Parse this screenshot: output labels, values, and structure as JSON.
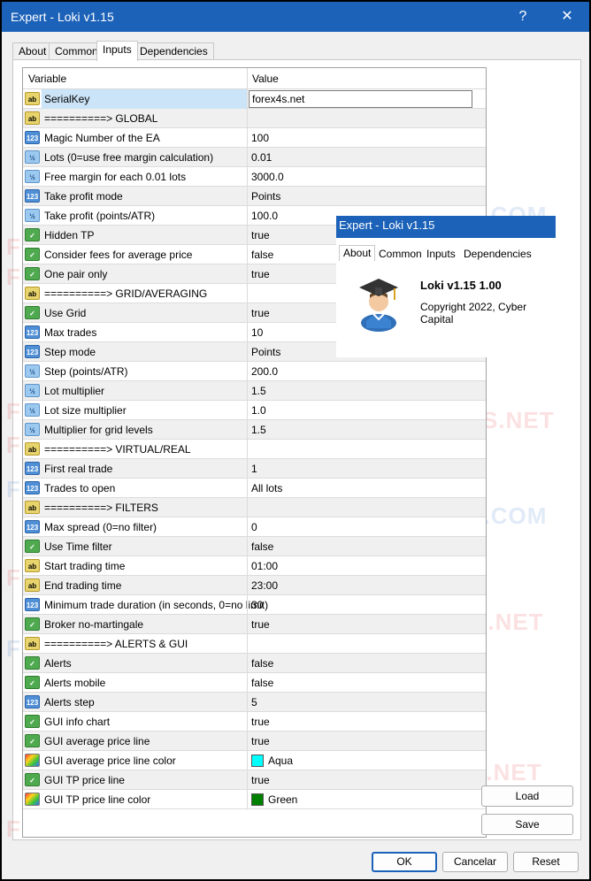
{
  "window": {
    "title": "Expert - Loki v1.15",
    "help_glyph": "?",
    "close_glyph": "✕"
  },
  "tabs": [
    {
      "label": "About"
    },
    {
      "label": "Common"
    },
    {
      "label": "Inputs"
    },
    {
      "label": "Dependencies"
    }
  ],
  "grid": {
    "columns": {
      "variable": "Variable",
      "value": "Value"
    },
    "rows": [
      {
        "type": "ab",
        "icon_text": "ab",
        "variable": "SerialKey",
        "value": "forex4s.net"
      },
      {
        "type": "ab",
        "icon_text": "ab",
        "variable": "==========> GLOBAL",
        "value": ""
      },
      {
        "type": "num",
        "icon_text": "123",
        "variable": "Magic Number of the EA",
        "value": "100"
      },
      {
        "type": "frac",
        "icon_text": "½",
        "variable": "Lots (0=use free margin calculation)",
        "value": "0.01"
      },
      {
        "type": "frac",
        "icon_text": "½",
        "variable": "Free margin for each 0.01 lots",
        "value": "3000.0"
      },
      {
        "type": "num",
        "icon_text": "123",
        "variable": "Take profit mode",
        "value": "Points"
      },
      {
        "type": "frac",
        "icon_text": "½",
        "variable": "Take profit (points/ATR)",
        "value": "100.0"
      },
      {
        "type": "bool",
        "icon_text": "✓",
        "variable": "Hidden TP",
        "value": "true"
      },
      {
        "type": "bool",
        "icon_text": "✓",
        "variable": "Consider fees for average price",
        "value": "false"
      },
      {
        "type": "bool",
        "icon_text": "✓",
        "variable": "One pair only",
        "value": "true"
      },
      {
        "type": "ab",
        "icon_text": "ab",
        "variable": "==========> GRID/AVERAGING",
        "value": ""
      },
      {
        "type": "bool",
        "icon_text": "✓",
        "variable": "Use Grid",
        "value": "true"
      },
      {
        "type": "num",
        "icon_text": "123",
        "variable": "Max trades",
        "value": "10"
      },
      {
        "type": "num",
        "icon_text": "123",
        "variable": "Step mode",
        "value": "Points"
      },
      {
        "type": "frac",
        "icon_text": "½",
        "variable": "Step (points/ATR)",
        "value": "200.0"
      },
      {
        "type": "frac",
        "icon_text": "½",
        "variable": "Lot multiplier",
        "value": "1.5"
      },
      {
        "type": "frac",
        "icon_text": "½",
        "variable": "Lot size multiplier",
        "value": "1.0"
      },
      {
        "type": "frac",
        "icon_text": "½",
        "variable": "Multiplier for grid levels",
        "value": "1.5"
      },
      {
        "type": "ab",
        "icon_text": "ab",
        "variable": "==========> VIRTUAL/REAL",
        "value": ""
      },
      {
        "type": "num",
        "icon_text": "123",
        "variable": "First real trade",
        "value": "1"
      },
      {
        "type": "num",
        "icon_text": "123",
        "variable": "Trades to open",
        "value": "All lots"
      },
      {
        "type": "ab",
        "icon_text": "ab",
        "variable": "==========> FILTERS",
        "value": ""
      },
      {
        "type": "num",
        "icon_text": "123",
        "variable": "Max spread (0=no filter)",
        "value": "0"
      },
      {
        "type": "bool",
        "icon_text": "✓",
        "variable": "Use Time filter",
        "value": "false"
      },
      {
        "type": "ab",
        "icon_text": "ab",
        "variable": "Start trading time",
        "value": "01:00"
      },
      {
        "type": "ab",
        "icon_text": "ab",
        "variable": "End trading time",
        "value": "23:00"
      },
      {
        "type": "num",
        "icon_text": "123",
        "variable": "Minimum trade duration (in seconds, 0=no limit)",
        "value": "30"
      },
      {
        "type": "bool",
        "icon_text": "✓",
        "variable": "Broker no-martingale",
        "value": "true"
      },
      {
        "type": "ab",
        "icon_text": "ab",
        "variable": "==========> ALERTS & GUI",
        "value": ""
      },
      {
        "type": "bool",
        "icon_text": "✓",
        "variable": "Alerts",
        "value": "false"
      },
      {
        "type": "bool",
        "icon_text": "✓",
        "variable": "Alerts mobile",
        "value": "false"
      },
      {
        "type": "num",
        "icon_text": "123",
        "variable": "Alerts step",
        "value": "5"
      },
      {
        "type": "bool",
        "icon_text": "✓",
        "variable": "GUI info chart",
        "value": "true"
      },
      {
        "type": "bool",
        "icon_text": "✓",
        "variable": "GUI average price line",
        "value": "true"
      },
      {
        "type": "color",
        "icon_text": "",
        "variable": "GUI average price line color",
        "value": "Aqua",
        "swatch": "#00ffff"
      },
      {
        "type": "bool",
        "icon_text": "✓",
        "variable": "GUI TP price line",
        "value": "true"
      },
      {
        "type": "color",
        "icon_text": "",
        "variable": "GUI TP price line color",
        "value": "Green",
        "swatch": "#008000"
      }
    ]
  },
  "side_buttons": {
    "load": "Load",
    "save": "Save"
  },
  "bottom_buttons": {
    "ok": "OK",
    "cancel": "Cancelar",
    "reset": "Reset"
  },
  "watermarks": [
    "FOREX4S.NET",
    "FOREX4S.NET",
    "FOREX4S.NET",
    "FOREX4S.NET",
    "FOREX4S.NET",
    "FOREX4S.NET",
    "FOREX4S.NET",
    "FOREX4S.NET",
    "FOREX4Y.COM",
    "FOREX4Y.COM",
    "FOREX4Y.COM",
    "FOREX4Y.COM",
    "FOREX4Y.COM",
    "FOREX4Y.COM",
    "FOREX4Y.COM",
    "FOREX4Y.COM",
    "FOREX4Y.NET",
    "FOREX4Y.NET",
    "FOREX4Y.NET",
    "FOREX4Y.NET",
    "FOREX4Y.NET",
    "FOREX4Y.NET",
    "FOREX4Y.NET"
  ],
  "about_popup": {
    "title": "Expert - Loki v1.15",
    "tabs": [
      "About",
      "Common",
      "Inputs",
      "Dependencies"
    ],
    "product": "Loki v1.15 1.00",
    "copyright": "Copyright 2022, Cyber Capital"
  },
  "colors": {
    "titlebar": "#1c62b9",
    "selected_cell": "#cce4f7",
    "alt_row": "#f0f0f0"
  }
}
